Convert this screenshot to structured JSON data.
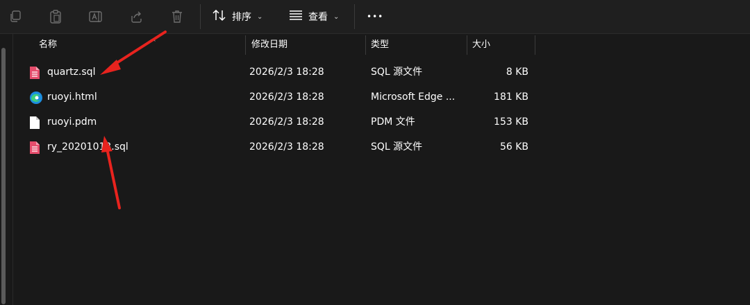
{
  "toolbar": {
    "icons": [
      "copy-icon",
      "paste-icon",
      "rename-icon",
      "share-icon",
      "delete-icon"
    ],
    "sort_label": "排序",
    "view_label": "查看",
    "more_label": "•••"
  },
  "columns": {
    "name": "名称",
    "modified": "修改日期",
    "type": "类型",
    "size": "大小"
  },
  "files": [
    {
      "name": "quartz.sql",
      "date": "2026/2/3 18:28",
      "type": "SQL 源文件",
      "size": "8 KB",
      "icon": "sql-file-icon"
    },
    {
      "name": "ruoyi.html",
      "date": "2026/2/3 18:28",
      "type": "Microsoft Edge ...",
      "size": "181 KB",
      "icon": "edge-icon"
    },
    {
      "name": "ruoyi.pdm",
      "date": "2026/2/3 18:28",
      "type": "PDM 文件",
      "size": "153 KB",
      "icon": "blank-file-icon"
    },
    {
      "name": "ry_20201013.sql",
      "date": "2026/2/3 18:28",
      "type": "SQL 源文件",
      "size": "56 KB",
      "icon": "sql-file-icon"
    }
  ],
  "colors": {
    "background": "#191919",
    "annotation_arrow": "#e8231e",
    "sql_icon": "#e64d6c"
  }
}
